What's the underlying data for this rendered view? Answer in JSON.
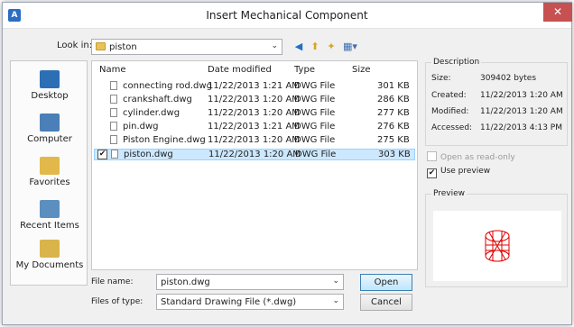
{
  "window": {
    "title": "Insert Mechanical Component",
    "close_glyph": "✕"
  },
  "lookin": {
    "label": "Look in:",
    "value": "piston"
  },
  "places": [
    {
      "label": "Desktop",
      "color": "#2d6fb5"
    },
    {
      "label": "Computer",
      "color": "#4a7fb8"
    },
    {
      "label": "Favorites",
      "color": "#e2b84a"
    },
    {
      "label": "Recent Items",
      "color": "#5b8fc0"
    },
    {
      "label": "My Documents",
      "color": "#d9b44a"
    }
  ],
  "columns": {
    "name": "Name",
    "date": "Date modified",
    "type": "Type",
    "size": "Size"
  },
  "files": [
    {
      "name": "connecting rod.dwg",
      "date": "11/22/2013 1:21 AM",
      "type": "DWG File",
      "size": "301 KB"
    },
    {
      "name": "crankshaft.dwg",
      "date": "11/22/2013 1:20 AM",
      "type": "DWG File",
      "size": "286 KB"
    },
    {
      "name": "cylinder.dwg",
      "date": "11/22/2013 1:20 AM",
      "type": "DWG File",
      "size": "277 KB"
    },
    {
      "name": "pin.dwg",
      "date": "11/22/2013 1:21 AM",
      "type": "DWG File",
      "size": "276 KB"
    },
    {
      "name": "Piston Engine.dwg",
      "date": "11/22/2013 1:20 AM",
      "type": "DWG File",
      "size": "275 KB"
    },
    {
      "name": "piston.dwg",
      "date": "11/22/2013 1:20 AM",
      "type": "DWG File",
      "size": "303 KB"
    }
  ],
  "filename": {
    "label": "File name:",
    "value": "piston.dwg"
  },
  "filetype": {
    "label": "Files of type:",
    "value": "Standard Drawing File (*.dwg)"
  },
  "buttons": {
    "open": "Open",
    "cancel": "Cancel"
  },
  "description": {
    "title": "Description",
    "size_label": "Size:",
    "size_value": "309402 bytes",
    "created_label": "Created:",
    "created_value": "11/22/2013 1:20 AM",
    "modified_label": "Modified:",
    "modified_value": "11/22/2013 1:20 AM",
    "accessed_label": "Accessed:",
    "accessed_value": "11/22/2013 4:13 PM"
  },
  "options": {
    "readonly": "Open as read-only",
    "use_preview": "Use preview"
  },
  "preview": {
    "title": "Preview"
  },
  "colors": {
    "selection": "#cce8ff",
    "preview_model": "#e00000"
  }
}
